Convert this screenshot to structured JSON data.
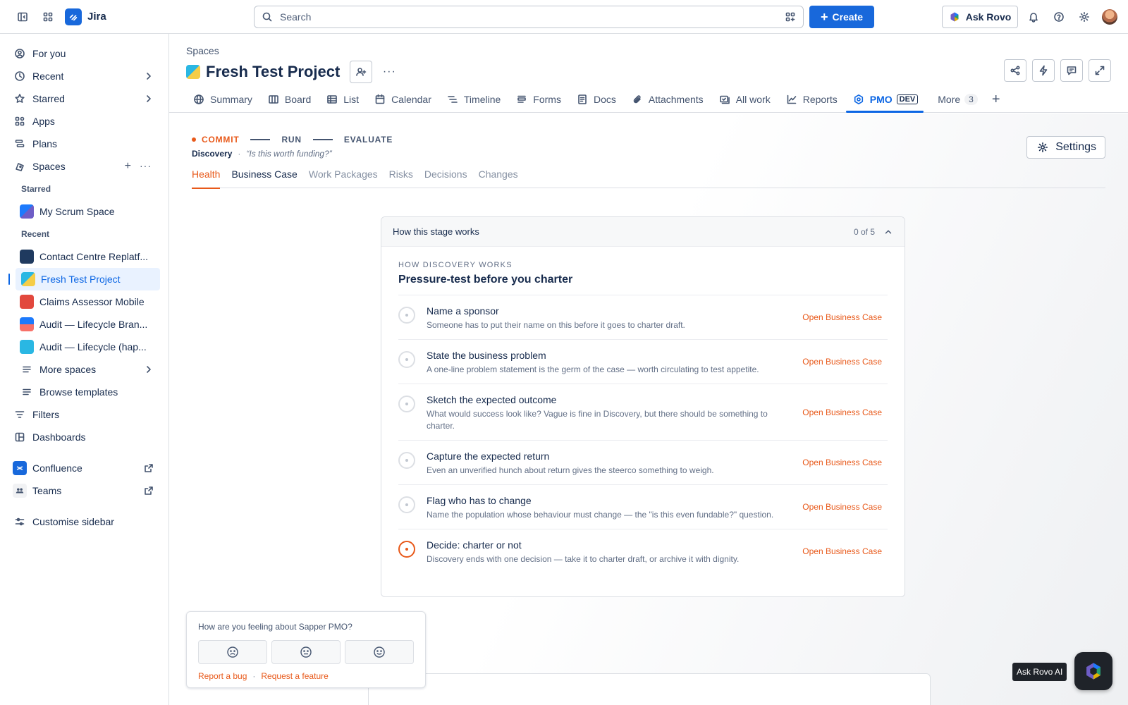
{
  "app": {
    "name": "Jira"
  },
  "topbar": {
    "search_placeholder": "Search",
    "create_label": "Create",
    "ask_rovo_label": "Ask Rovo"
  },
  "sidebar": {
    "items": [
      {
        "label": "For you",
        "icon": "user-circle-icon"
      },
      {
        "label": "Recent",
        "icon": "clock-icon"
      },
      {
        "label": "Starred",
        "icon": "star-icon"
      },
      {
        "label": "Apps",
        "icon": "apps-icon"
      },
      {
        "label": "Plans",
        "icon": "plans-icon"
      },
      {
        "label": "Spaces",
        "icon": "spaces-icon"
      }
    ],
    "starred_heading": "Starred",
    "starred": [
      {
        "label": "My Scrum Space"
      }
    ],
    "recent_heading": "Recent",
    "recent": [
      {
        "label": "Contact Centre Replatf..."
      },
      {
        "label": "Fresh Test Project"
      },
      {
        "label": "Claims Assessor Mobile"
      },
      {
        "label": "Audit — Lifecycle Bran..."
      },
      {
        "label": "Audit — Lifecycle (hap..."
      }
    ],
    "more_spaces": "More spaces",
    "browse_templates": "Browse templates",
    "filters": "Filters",
    "dashboards": "Dashboards",
    "confluence": "Confluence",
    "teams": "Teams",
    "customise": "Customise sidebar"
  },
  "header": {
    "breadcrumb": "Spaces",
    "title": "Fresh Test Project",
    "tabs": [
      {
        "label": "Summary"
      },
      {
        "label": "Board"
      },
      {
        "label": "List"
      },
      {
        "label": "Calendar"
      },
      {
        "label": "Timeline"
      },
      {
        "label": "Forms"
      },
      {
        "label": "Docs"
      },
      {
        "label": "Attachments"
      },
      {
        "label": "All work"
      },
      {
        "label": "Reports"
      },
      {
        "label": "PMO",
        "badge": "DEV"
      },
      {
        "label": "More",
        "count": "3"
      }
    ]
  },
  "stages": {
    "steps": [
      "COMMIT",
      "RUN",
      "EVALUATE"
    ],
    "current_name": "Discovery",
    "current_question": "“Is this worth funding?”",
    "settings_label": "Settings"
  },
  "subtabs": [
    "Health",
    "Business Case",
    "Work Packages",
    "Risks",
    "Decisions",
    "Changes"
  ],
  "panel": {
    "header": "How this stage works",
    "progress": "0 of 5",
    "eyebrow": "HOW DISCOVERY WORKS",
    "title": "Pressure-test before you charter",
    "steps": [
      {
        "title": "Name a sponsor",
        "desc": "Someone has to put their name on this before it goes to charter draft.",
        "link": "Open Business Case"
      },
      {
        "title": "State the business problem",
        "desc": "A one-line problem statement is the germ of the case — worth circulating to test appetite.",
        "link": "Open Business Case"
      },
      {
        "title": "Sketch the expected outcome",
        "desc": "What would success look like? Vague is fine in Discovery, but there should be something to charter.",
        "link": "Open Business Case"
      },
      {
        "title": "Capture the expected return",
        "desc": "Even an unverified hunch about return gives the steerco something to weigh.",
        "link": "Open Business Case"
      },
      {
        "title": "Flag who has to change",
        "desc": "Name the population whose behaviour must change — the \"is this even fundable?\" question.",
        "link": "Open Business Case"
      },
      {
        "title": "Decide: charter or not",
        "desc": "Discovery ends with one decision — take it to charter draft, or archive it with dignity.",
        "link": "Open Business Case"
      }
    ]
  },
  "feedback": {
    "question": "How are you feeling about Sapper PMO?",
    "report_bug": "Report a bug",
    "request_feature": "Request a feature",
    "separator": "·"
  },
  "rovo": {
    "tooltip": "Ask Rovo AI"
  },
  "colors": {
    "accent": "#e8591a",
    "primary": "#1868db",
    "selected": "#0c66e4"
  }
}
